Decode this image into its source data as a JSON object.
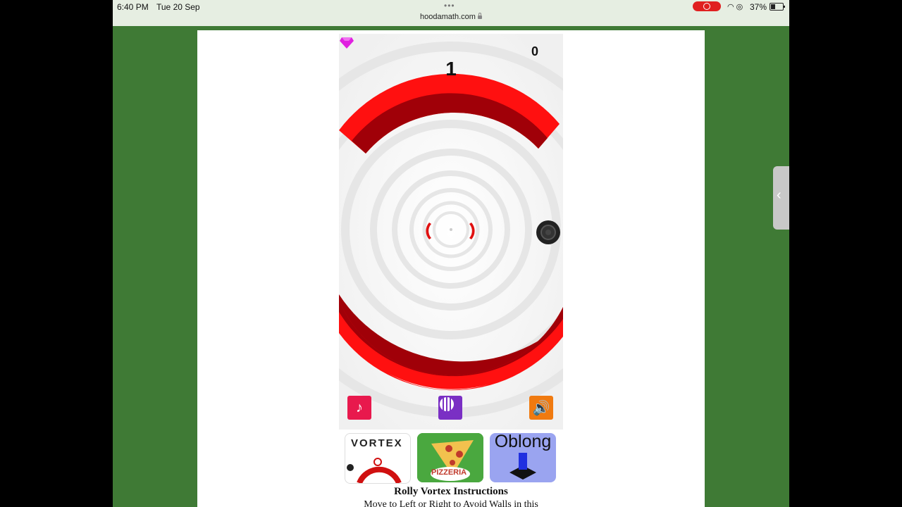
{
  "status_bar": {
    "time": "6:40 PM",
    "date": "Tue 20 Sep",
    "url": "hoodamath.com",
    "battery": "37%",
    "tab_dots": "•••"
  },
  "game": {
    "gem_count": "0",
    "score": "1",
    "controls": {
      "music_icon": "music-note-icon",
      "skin_icon": "ball-skin-icon",
      "sound_icon": "speaker-icon"
    },
    "colors": {
      "wall_light": "#ff1010",
      "wall_dark": "#a00008",
      "gem": "#e020e0"
    }
  },
  "related_games": [
    {
      "title": "VORTEX"
    },
    {
      "title": "PIZZERIA"
    },
    {
      "title": "Oblong"
    }
  ],
  "instructions": {
    "title": "Rolly Vortex Instructions",
    "text": "Move to Left or Right to Avoid Walls in this"
  }
}
